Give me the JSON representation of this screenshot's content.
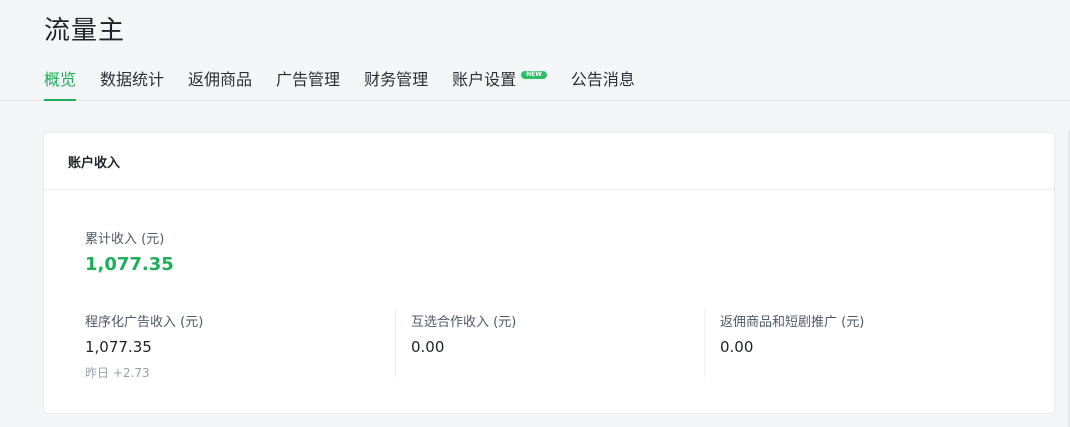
{
  "app": {
    "title": "流量主"
  },
  "tabs": [
    {
      "label": "概览",
      "active": true
    },
    {
      "label": "数据统计"
    },
    {
      "label": "返佣商品"
    },
    {
      "label": "广告管理"
    },
    {
      "label": "财务管理"
    },
    {
      "label": "账户设置",
      "badge": "NEW"
    },
    {
      "label": "公告消息"
    }
  ],
  "account_income": {
    "title": "账户收入",
    "total": {
      "label": "累计收入 (元)",
      "value": "1,077.35"
    },
    "stats": [
      {
        "label": "程序化广告收入 (元)",
        "value": "1,077.35",
        "sub": "昨日 +2.73"
      },
      {
        "label": "互选合作收入 (元)",
        "value": "0.00"
      },
      {
        "label": "返佣商品和短剧推广 (元)",
        "value": "0.00"
      }
    ]
  },
  "colors": {
    "accent": "#1fae5a",
    "badge": "#2cbf64"
  }
}
